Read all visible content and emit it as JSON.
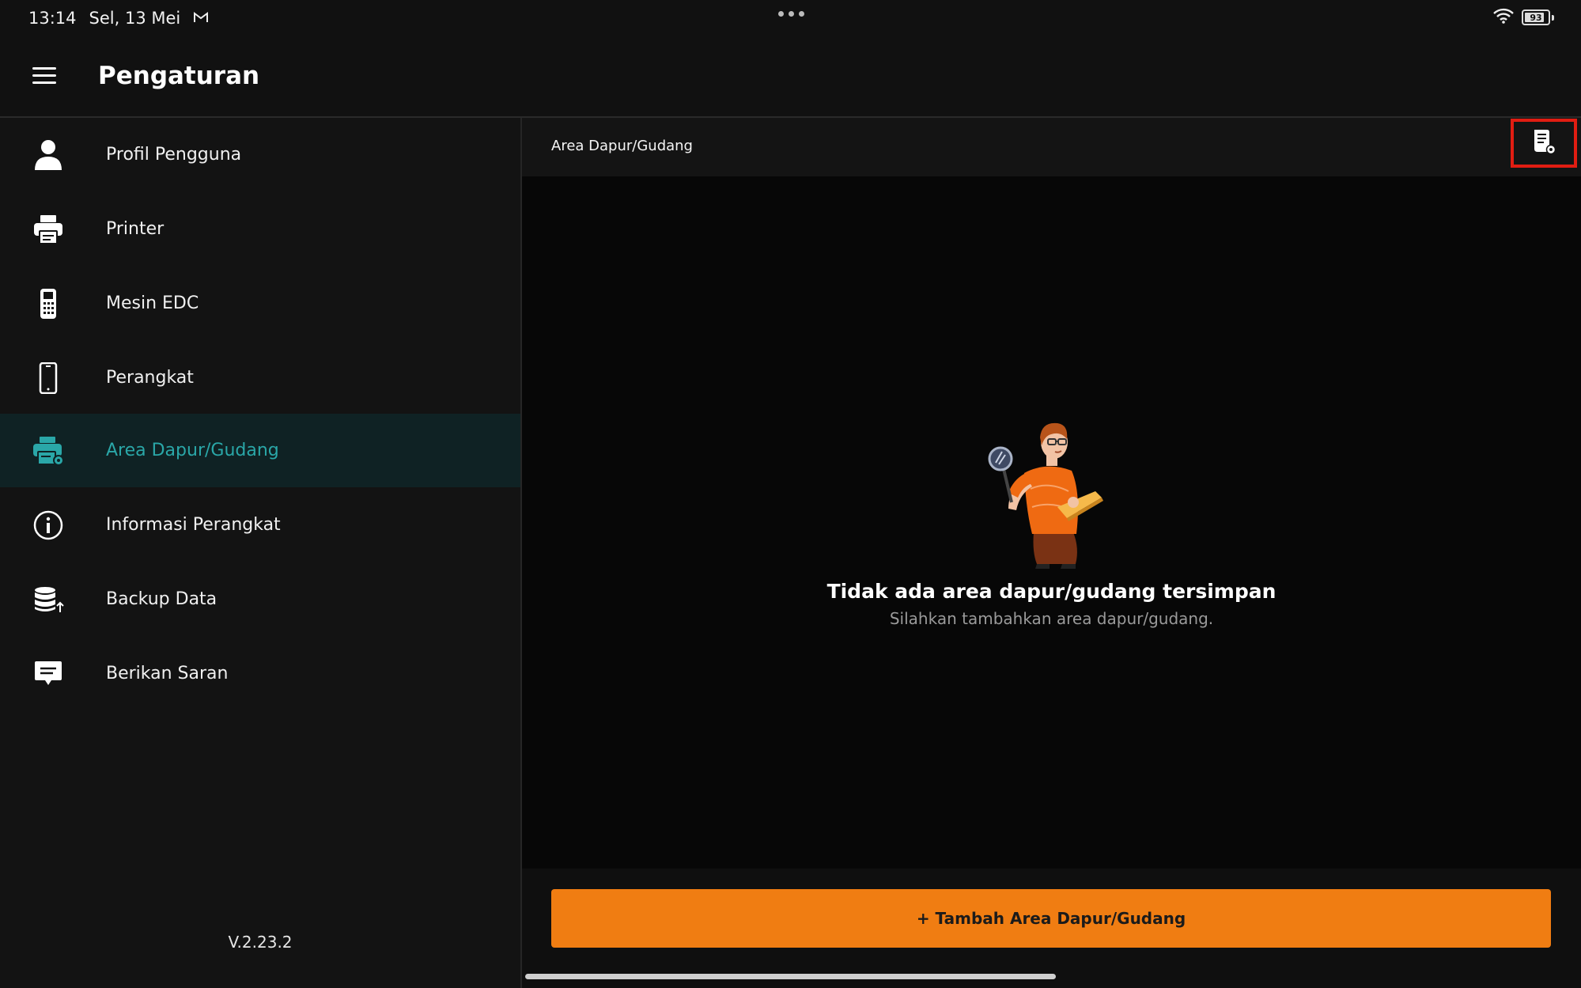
{
  "status_bar": {
    "time": "13:14",
    "date": "Sel, 13 Mei",
    "notification_icon": "gmail-icon",
    "battery": "93"
  },
  "app_bar": {
    "menu_icon": "hamburger-menu-icon",
    "title": "Pengaturan"
  },
  "sidebar": {
    "items": [
      {
        "label": "Profil Pengguna",
        "icon": "user-icon",
        "active": false
      },
      {
        "label": "Printer",
        "icon": "printer-icon",
        "active": false
      },
      {
        "label": "Mesin EDC",
        "icon": "edc-machine-icon",
        "active": false
      },
      {
        "label": "Perangkat",
        "icon": "phone-icon",
        "active": false
      },
      {
        "label": "Area Dapur/Gudang",
        "icon": "kitchen-printer-icon",
        "active": true
      },
      {
        "label": "Informasi Perangkat",
        "icon": "info-icon",
        "active": false
      },
      {
        "label": "Backup Data",
        "icon": "database-upload-icon",
        "active": false
      },
      {
        "label": "Berikan Saran",
        "icon": "feedback-icon",
        "active": false
      }
    ],
    "version": "V.2.23.2"
  },
  "main": {
    "header_title": "Area Dapur/Gudang",
    "header_action_icon": "document-settings-icon",
    "empty_state": {
      "illustration": "person-with-magnifier-illustration",
      "title": "Tidak ada area dapur/gudang tersimpan",
      "subtitle": "Silahkan tambahkan area dapur/gudang."
    },
    "add_button_label": "+ Tambah Area Dapur/Gudang"
  },
  "colors": {
    "accent_teal": "#2aa7a8",
    "button_orange": "#f07d12",
    "highlight_red": "#e11d12"
  }
}
